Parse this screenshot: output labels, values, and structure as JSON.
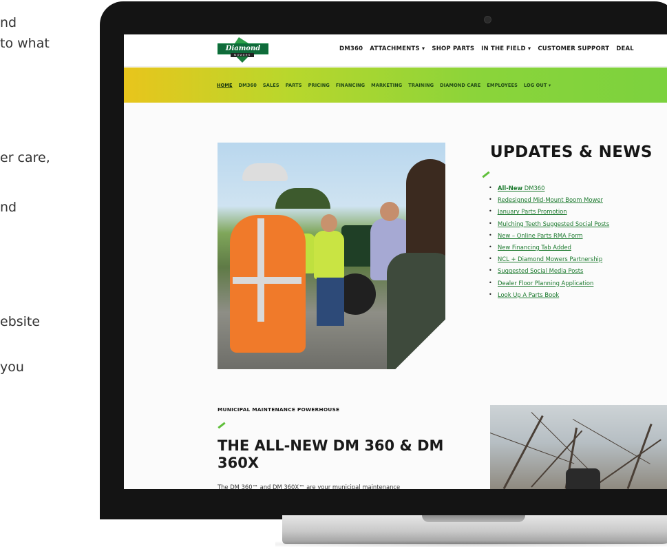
{
  "side_text": {
    "lines": [
      "nd",
      "to what",
      "er care,",
      "nd",
      "ebsite",
      "you"
    ]
  },
  "site": {
    "logo": {
      "text": "Diamond",
      "subtext": "MOWERS"
    },
    "top_nav": [
      "DM360",
      "ATTACHMENTS ▾",
      "SHOP PARTS",
      "IN THE FIELD ▾",
      "CUSTOMER SUPPORT",
      "DEAL"
    ],
    "sub_nav": [
      "HOME",
      "DM360",
      "SALES",
      "PARTS",
      "PRICING",
      "FINANCING",
      "MARKETING",
      "TRAINING",
      "DIAMOND CARE",
      "EMPLOYEES",
      "LOG OUT ▾"
    ],
    "sub_nav_active": "HOME"
  },
  "updates": {
    "title": "UPDATES & NEWS",
    "first_strong": "All-New",
    "first_rest": " DM360",
    "items": [
      "Redesigned Mid-Mount Boom Mower",
      "January Parts Promotion",
      "Mulching Teeth Suggested Social Posts",
      "New – Online Parts RMA Form",
      "New Financing Tab Added",
      "NCL + Diamond Mowers Partnership",
      "Suggested Social Media Posts",
      "Dealer Floor Planning Application",
      "Look Up A Parts Book"
    ]
  },
  "feature": {
    "eyebrow": "MUNICIPAL MAINTENANCE POWERHOUSE",
    "title": "THE ALL-NEW DM 360 & DM 360X",
    "body": "The DM 360™ and DM 360X™ are your municipal maintenance"
  },
  "colors": {
    "brand_green": "#1d7a2f",
    "accent_lime": "#7cd23e",
    "accent_yellow": "#e8c51c"
  }
}
